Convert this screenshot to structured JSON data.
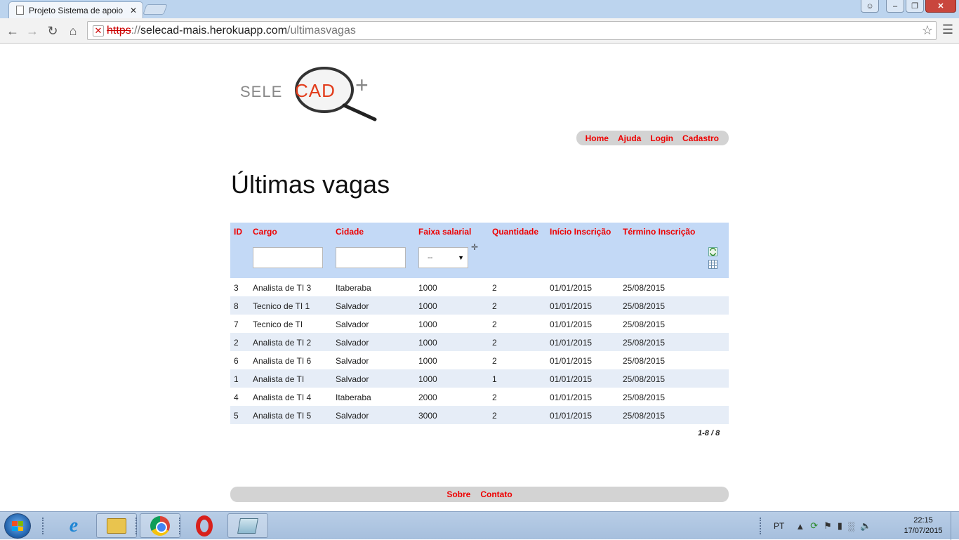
{
  "browser": {
    "tab_title": "Projeto Sistema de apoio",
    "tab_close": "✕",
    "url_scheme": "https",
    "url_sep": "://",
    "url_host": "selecad-mais.herokuapp.com",
    "url_path": "/ultimasvagas",
    "icons": [
      "back-arrow-icon",
      "forward-arrow-icon",
      "reload-icon",
      "home-icon",
      "insecure-lock-icon",
      "star-icon",
      "menu-icon"
    ]
  },
  "logo": {
    "text_left": "SELE",
    "text_highlight": "CAD",
    "text_plus": "+"
  },
  "topnav": {
    "items": [
      "Home",
      "Ajuda",
      "Login",
      "Cadastro"
    ]
  },
  "page_title": "Últimas vagas",
  "grid": {
    "columns": [
      "ID",
      "Cargo",
      "Cidade",
      "Faixa salarial",
      "Quantidade",
      "Início Inscrição",
      "Término Inscrição"
    ],
    "filter_select_value": "--",
    "rows": [
      [
        "3",
        "Analista de TI 3",
        "Itaberaba",
        "1000",
        "2",
        "01/01/2015",
        "25/08/2015"
      ],
      [
        "8",
        "Tecnico de TI 1",
        "Salvador",
        "1000",
        "2",
        "01/01/2015",
        "25/08/2015"
      ],
      [
        "7",
        "Tecnico de TI",
        "Salvador",
        "1000",
        "2",
        "01/01/2015",
        "25/08/2015"
      ],
      [
        "2",
        "Analista de TI 2",
        "Salvador",
        "1000",
        "2",
        "01/01/2015",
        "25/08/2015"
      ],
      [
        "6",
        "Analista de TI 6",
        "Salvador",
        "1000",
        "2",
        "01/01/2015",
        "25/08/2015"
      ],
      [
        "1",
        "Analista de TI",
        "Salvador",
        "1000",
        "1",
        "01/01/2015",
        "25/08/2015"
      ],
      [
        "4",
        "Analista de TI 4",
        "Itaberaba",
        "2000",
        "2",
        "01/01/2015",
        "25/08/2015"
      ],
      [
        "5",
        "Analista de TI 5",
        "Salvador",
        "3000",
        "2",
        "01/01/2015",
        "25/08/2015"
      ]
    ],
    "pager": "1-8 / 8"
  },
  "footnav": {
    "items": [
      "Sobre",
      "Contato"
    ]
  },
  "taskbar": {
    "language": "PT",
    "time": "22:15",
    "date": "17/07/2015"
  },
  "colors": {
    "accent": "#ee0000",
    "grid_header": "#c3d9f6",
    "row_alt": "#e6edf7",
    "nav_bg": "#d3d3d3"
  }
}
